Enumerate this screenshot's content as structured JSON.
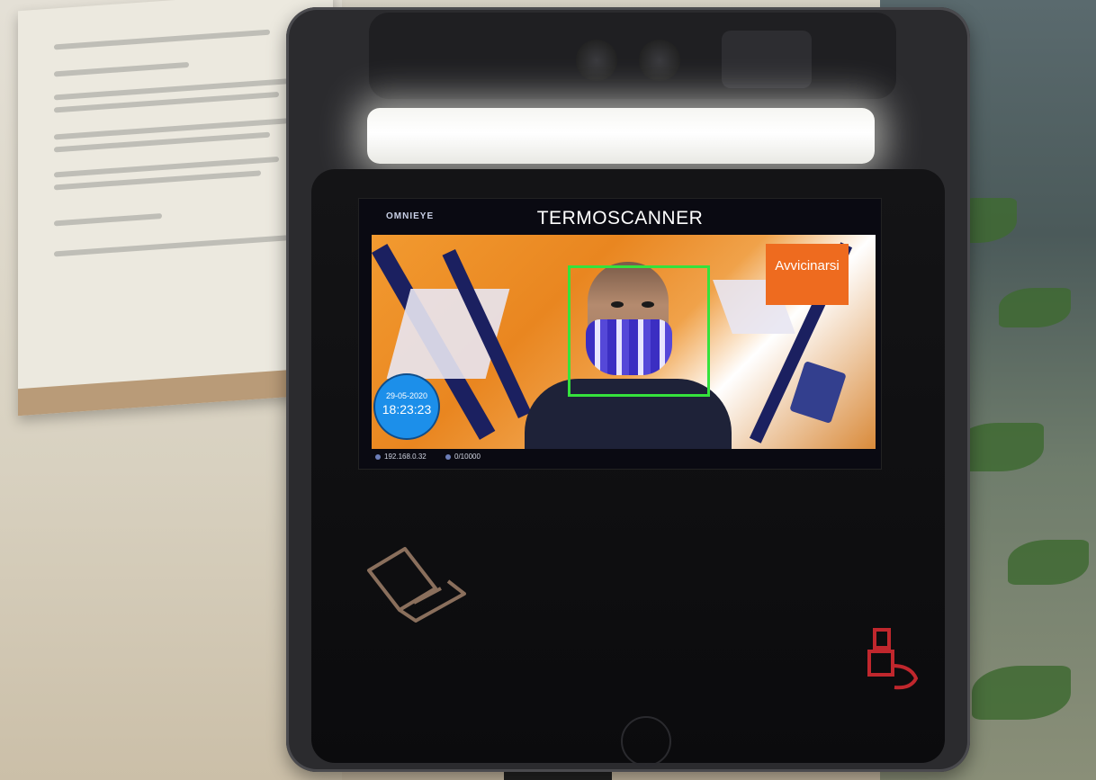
{
  "screen": {
    "brand": "OMNIEYE",
    "title": "TERMOSCANNER",
    "status_message": "Avvicinarsi",
    "clock": {
      "date": "29-05-2020",
      "time": "18:23:23"
    },
    "status_bar": {
      "ip": "192.168.0.32",
      "counter": "0/10000"
    }
  },
  "colors": {
    "face_box": "#35e23c",
    "badge": "#ee6b1f",
    "clock": "#1c8fea"
  },
  "icons": [
    "card-reader-icon",
    "hand-sanitizer-icon",
    "camera-icon"
  ]
}
